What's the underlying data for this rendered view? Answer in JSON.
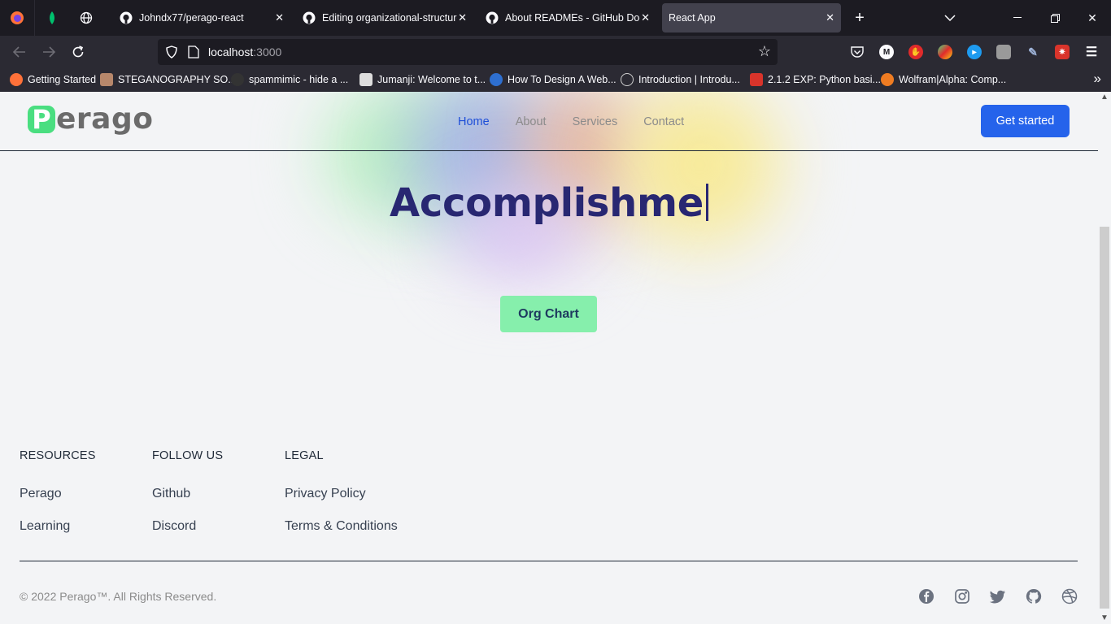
{
  "browser": {
    "tabs": [
      {
        "title": "Johndx77/perago-react"
      },
      {
        "title": "Editing organizational-structure"
      },
      {
        "title": "About READMEs - GitHub Docs"
      },
      {
        "title": "React App"
      }
    ],
    "url": {
      "host": "localhost",
      "port": ":3000"
    },
    "bookmarks": [
      {
        "label": "Getting Started",
        "color": "#ff7139"
      },
      {
        "label": "STEGANOGRAPHY SO...",
        "color": "#b7876b"
      },
      {
        "label": "spammimic - hide a ...",
        "color": "#333333"
      },
      {
        "label": "Jumanji: Welcome to t...",
        "color": "#dddddd"
      },
      {
        "label": "How To Design A Web...",
        "color": "#2e6fd0"
      },
      {
        "label": "Introduction | Introdu...",
        "color": "#cfcfcf"
      },
      {
        "label": "2.1.2 EXP: Python basi...",
        "color": "#d9342b"
      },
      {
        "label": "Wolfram|Alpha: Comp...",
        "color": "#ef7c22"
      }
    ]
  },
  "site": {
    "logo": {
      "mark": "P",
      "text": "erago"
    },
    "nav": [
      "Home",
      "About",
      "Services",
      "Contact"
    ],
    "cta": "Get started",
    "hero": {
      "title": "Accomplishme",
      "button": "Org Chart"
    },
    "footer": {
      "columns": [
        {
          "heading": "RESOURCES",
          "links": [
            "Perago",
            "Learning"
          ]
        },
        {
          "heading": "FOLLOW US",
          "links": [
            "Github",
            "Discord"
          ]
        },
        {
          "heading": "LEGAL",
          "links": [
            "Privacy Policy",
            "Terms & Conditions"
          ]
        }
      ],
      "copyright": "© 2022 Perago™. All Rights Reserved.",
      "social_icons": [
        "facebook-icon",
        "instagram-icon",
        "twitter-icon",
        "github-icon",
        "dribbble-icon"
      ]
    },
    "colors": {
      "accent": "#2563eb",
      "brand_green": "#4ade80",
      "hero_text": "#282772",
      "button_green": "#86efac"
    }
  }
}
